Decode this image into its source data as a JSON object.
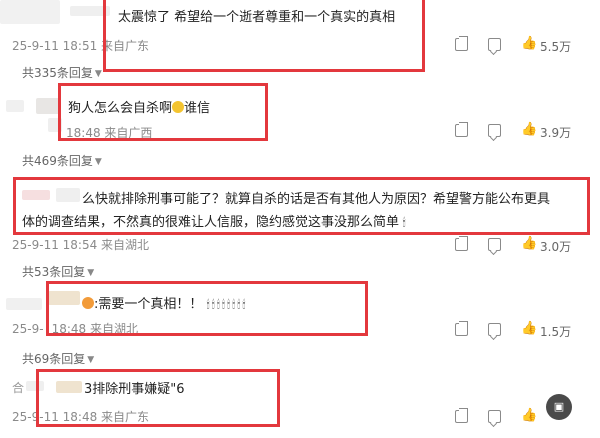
{
  "comments": [
    {
      "text": "太震惊了 希望给一个逝者尊重和一个真实的真相",
      "meta": "25-9-11 18:51 来自广东",
      "share_count": "",
      "like_count": "5.5万",
      "replies": "共335条回复"
    },
    {
      "text": "狗人怎么会自杀啊",
      "text_suffix": "谁信",
      "meta": "18:48 来自广西",
      "like_count": "3.9万",
      "replies": "共469条回复"
    },
    {
      "text_line1": "么快就排除刑事可能了？就算自杀的话是否有其他人为原因？希望警方能公布更具",
      "text_line2": "体的调查结果，不然真的很难让人信服，隐约感觉这事没那么简单",
      "meta": "25-9-11 18:54 来自湖北",
      "like_count": "3.0万",
      "replies": "共53条回复"
    },
    {
      "text": ":需要一个真相！！",
      "candles": "🕯🕯🕯🕯🕯🕯🕯🕯",
      "meta_prefix": "25-9-",
      "meta": "18:48 来自湖北",
      "like_count": "1.5万",
      "replies": "共69条回复"
    },
    {
      "author_prefix": "合",
      "text": "3排除刑事嫌疑\"6",
      "meta": "25-9-11 18:48 来自广东",
      "like_count": "",
      "replies": ""
    }
  ],
  "icons": {
    "share": "share-icon",
    "comment": "comment-icon",
    "like": "like-icon"
  },
  "colors": {
    "highlight_box": "#e3383d",
    "meta_text": "#8a8a8a"
  }
}
